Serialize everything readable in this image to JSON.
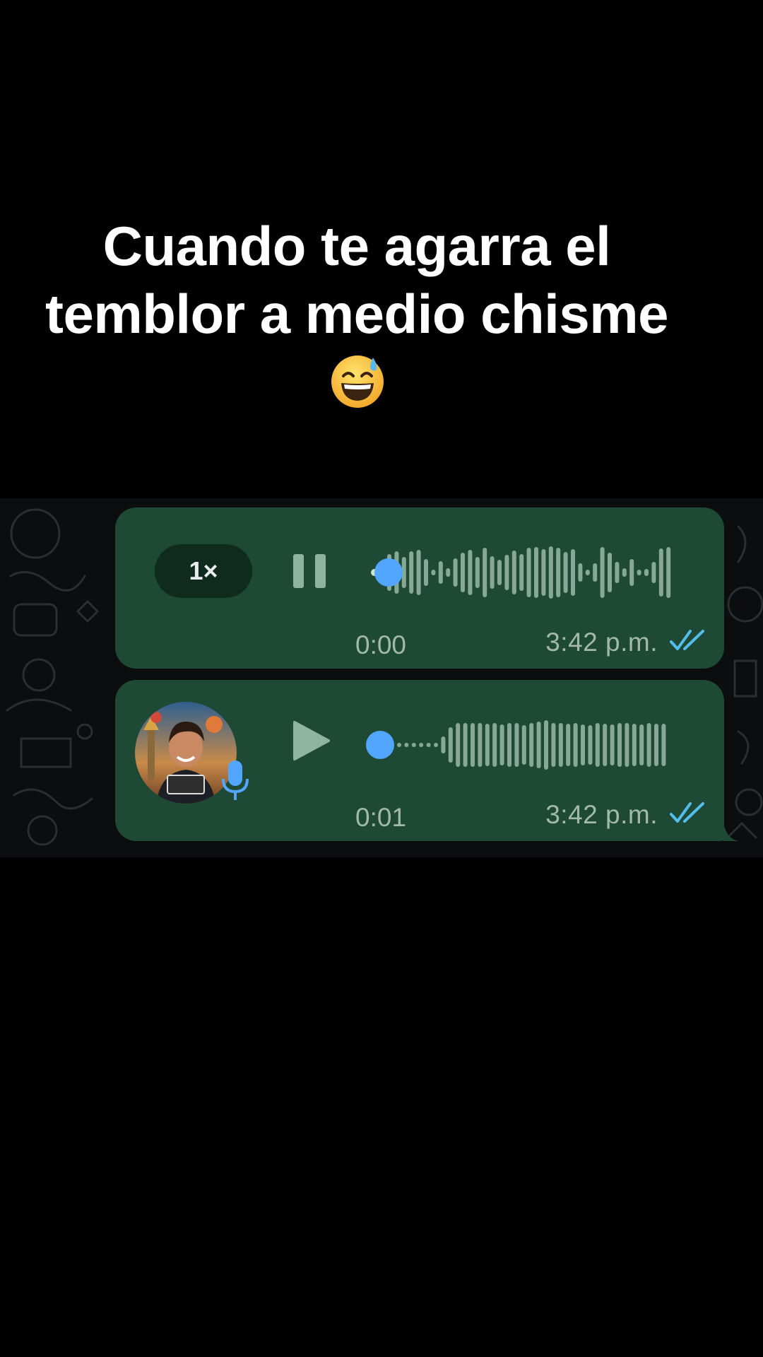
{
  "caption": {
    "line1": "Cuando te agarra el",
    "line2": "temblor a medio chisme",
    "emoji": "grinning-face-with-sweat"
  },
  "messages": [
    {
      "speed_label": "1×",
      "control": "pause-icon",
      "progress": 0.0,
      "elapsed": "0:00",
      "timestamp": "3:42 p.m.",
      "status": "read-double-check"
    },
    {
      "control": "play-icon",
      "avatar": "sender-avatar",
      "mic_icon": "microphone-icon",
      "progress": 0.0,
      "elapsed": "0:01",
      "timestamp": "3:42 p.m.",
      "status": "read-double-check"
    }
  ],
  "colors": {
    "bubble": "#1e4a35",
    "waveform": "#86a894",
    "progress_knob": "#53a6ff",
    "read_ticks": "#53bdeb",
    "chat_bg": "#0b0d0e"
  }
}
